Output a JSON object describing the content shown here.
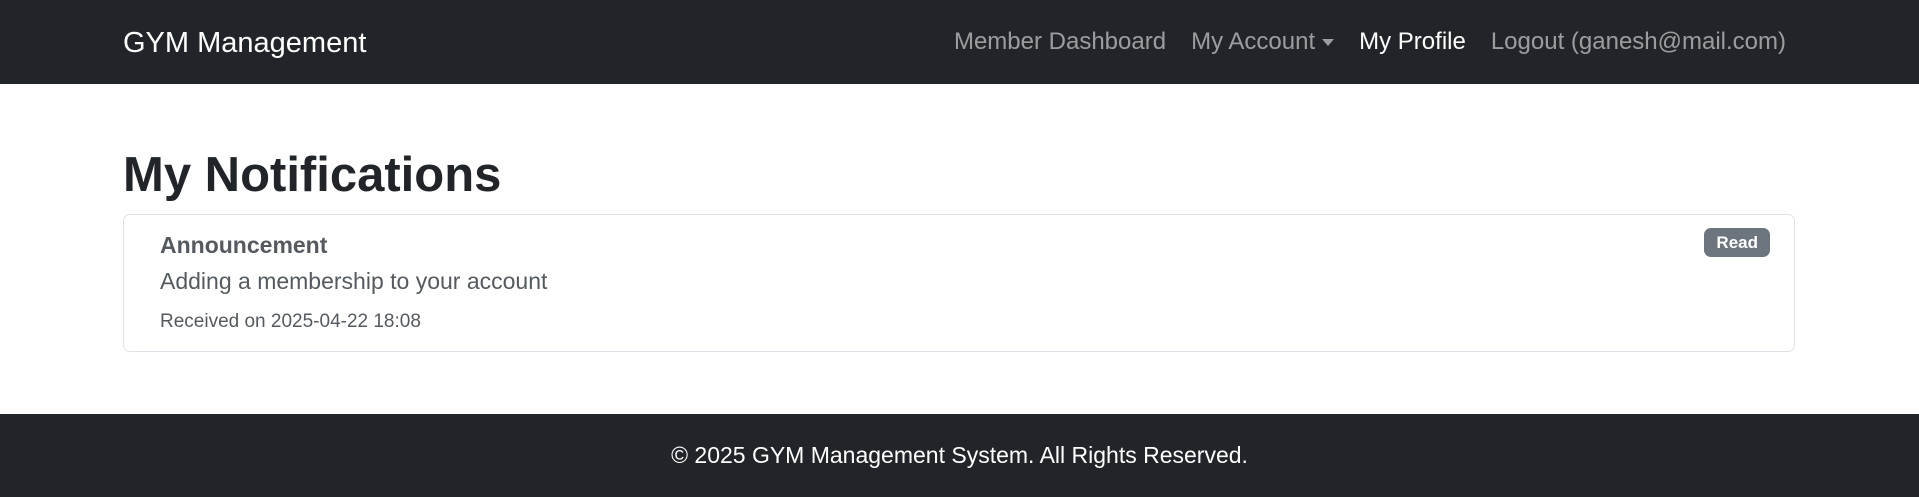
{
  "navbar": {
    "brand": "GYM Management",
    "links": [
      {
        "label": "Member Dashboard",
        "active": false
      },
      {
        "label": "My Account",
        "active": false,
        "dropdown": true
      },
      {
        "label": "My Profile",
        "active": true
      },
      {
        "label": "Logout (ganesh@mail.com)",
        "active": false
      }
    ]
  },
  "main": {
    "title": "My Notifications",
    "notifications": [
      {
        "heading": "Announcement",
        "message": "Adding a membership to your account",
        "received": "Received on 2025-04-22 18:08",
        "status": "Read"
      }
    ]
  },
  "footer": {
    "text": "© 2025 GYM Management System. All Rights Reserved."
  },
  "colors": {
    "navbar_bg": "#212529",
    "badge_bg": "#6c757d",
    "text_muted": "#555a60"
  }
}
